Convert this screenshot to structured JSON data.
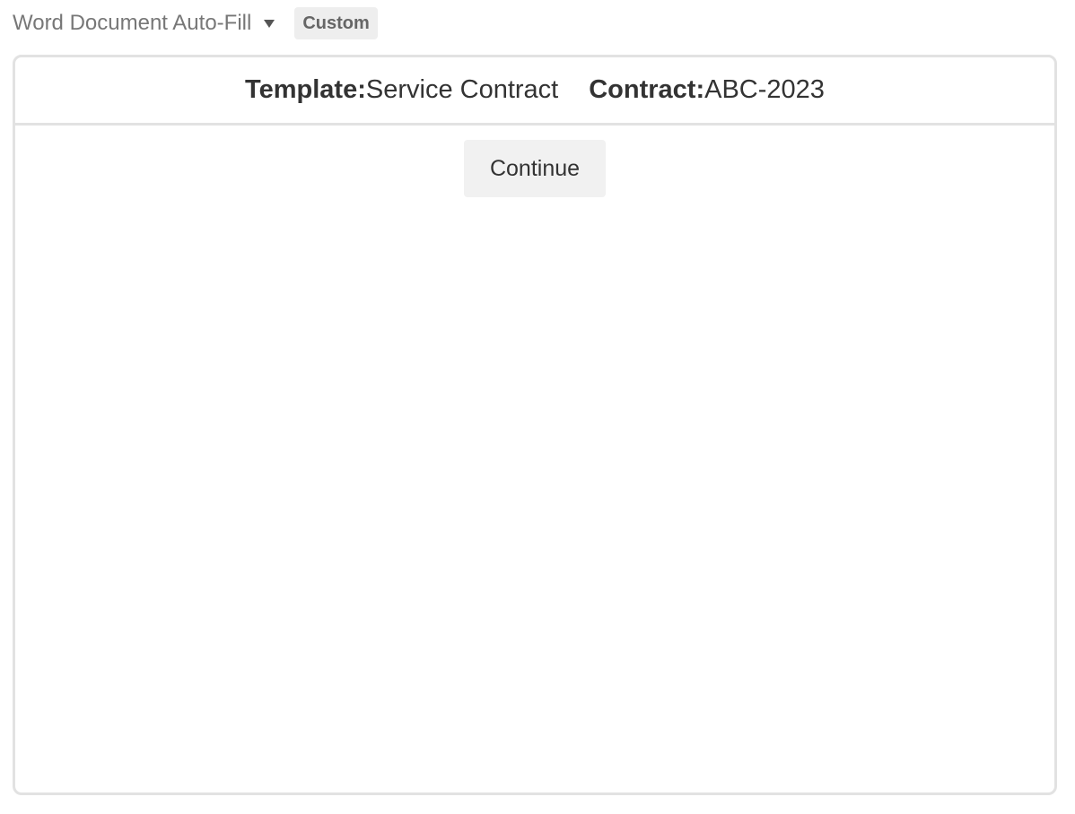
{
  "header": {
    "app_title": "Word Document Auto-Fill",
    "dropdown_icon": "caret-down-icon",
    "badge": "Custom"
  },
  "panel": {
    "template_label": "Template:",
    "template_value": "Service Contract",
    "contract_label": "Contract:",
    "contract_value": "ABC-2023",
    "continue_label": "Continue"
  },
  "colors": {
    "border": "#e2e2e2",
    "button_bg": "#f1f1f1",
    "badge_bg": "#eeeeee",
    "title_text": "#777777",
    "body_text": "#333333"
  }
}
